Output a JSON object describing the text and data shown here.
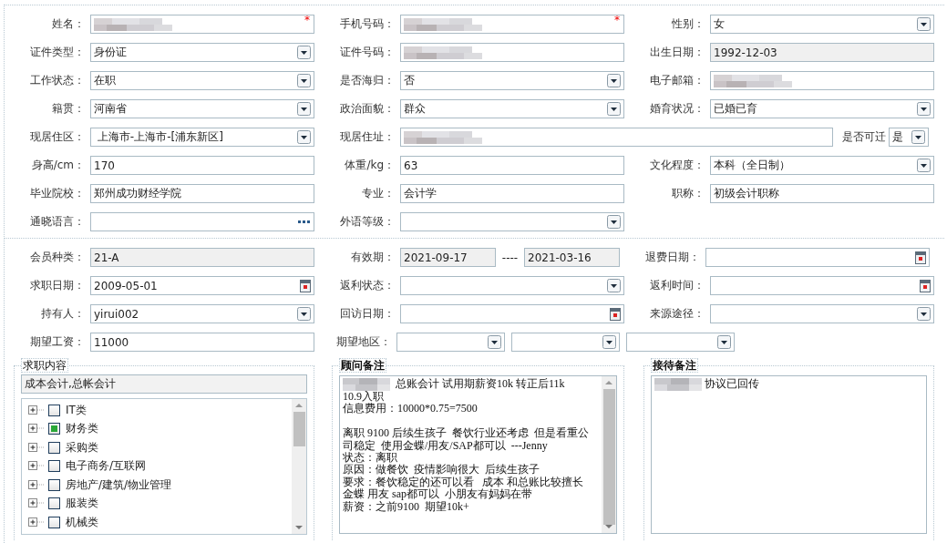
{
  "sections": [
    {
      "rows": [
        {
          "cells": [
            {
              "label": "姓名：",
              "kind": "text",
              "redacted": true,
              "required_mark": "*"
            },
            {
              "label": "手机号码：",
              "kind": "text",
              "redacted": true,
              "required_mark": "*"
            },
            {
              "label": "性别：",
              "kind": "select",
              "value": "女"
            }
          ]
        },
        {
          "cells": [
            {
              "label": "证件类型：",
              "kind": "select",
              "value": "身份证"
            },
            {
              "label": "证件号码：",
              "kind": "text",
              "redacted": true
            },
            {
              "label": "出生日期：",
              "kind": "readonly",
              "value": "1992-12-03"
            }
          ]
        },
        {
          "cells": [
            {
              "label": "工作状态：",
              "kind": "select",
              "value": "在职"
            },
            {
              "label": "是否海归：",
              "kind": "select",
              "value": "否"
            },
            {
              "label": "电子邮箱：",
              "kind": "text",
              "redacted": true
            }
          ]
        },
        {
          "cells": [
            {
              "label": "籍贯：",
              "kind": "select",
              "value": "河南省"
            },
            {
              "label": "政治面貌：",
              "kind": "select",
              "value": "群众"
            },
            {
              "label": "婚育状况：",
              "kind": "select",
              "value": "已婚已育"
            }
          ]
        },
        {
          "cells": [
            {
              "label": "现居住区：",
              "kind": "select",
              "value": " 上海市-上海市-[浦东新区]"
            },
            {
              "label": "现居住址：",
              "kind": "wide-text",
              "redacted": true
            },
            {
              "label": "是否可迁",
              "kind": "small-select",
              "value": "是"
            }
          ]
        },
        {
          "cells": [
            {
              "label": "身高/cm：",
              "kind": "text",
              "value": "170"
            },
            {
              "label": "体重/kg：",
              "kind": "text",
              "value": "63"
            },
            {
              "label": "文化程度：",
              "kind": "select",
              "value": "本科（全日制）"
            }
          ]
        },
        {
          "cells": [
            {
              "label": "毕业院校：",
              "kind": "text",
              "value": "郑州成功财经学院"
            },
            {
              "label": "专业：",
              "kind": "text",
              "value": "会计学"
            },
            {
              "label": "职称：",
              "kind": "text",
              "value": "初级会计职称"
            }
          ]
        },
        {
          "cells": [
            {
              "label": "通晓语言：",
              "kind": "lookup"
            },
            {
              "label": "外语等级：",
              "kind": "select"
            }
          ]
        }
      ]
    },
    {
      "rows": [
        {
          "cells": [
            {
              "label": "会员种类：",
              "kind": "readonly",
              "value": "21-A"
            },
            {
              "label": "有效期：",
              "kind": "date-range",
              "from": "2021-09-17",
              "separator": "----",
              "to": "2021-03-16"
            },
            {
              "label": "退费日期：",
              "kind": "date"
            }
          ]
        },
        {
          "cells": [
            {
              "label": "求职日期：",
              "kind": "date",
              "value": "2009-05-01"
            },
            {
              "label": "返利状态：",
              "kind": "select"
            },
            {
              "label": "返利时间：",
              "kind": "date"
            }
          ]
        },
        {
          "cells": [
            {
              "label": "持有人：",
              "kind": "select",
              "value": "yirui002"
            },
            {
              "label": "回访日期：",
              "kind": "date"
            },
            {
              "label": "来源途径：",
              "kind": "select"
            }
          ]
        },
        {
          "cells": [
            {
              "label": "期望工资：",
              "kind": "text",
              "value": "11000"
            },
            {
              "label": "期望地区：",
              "kind": "triple-select",
              "parts": [
                {
                  "kind": "select"
                },
                {
                  "kind": "select"
                },
                {
                  "kind": "select"
                }
              ]
            }
          ]
        }
      ]
    }
  ],
  "job_panel": {
    "legend": "求职内容",
    "summary": "成本会计,总帐会计",
    "tree": [
      {
        "label": "IT类",
        "checked": false,
        "expanded": false
      },
      {
        "label": "财务类",
        "checked": true,
        "expanded": false
      },
      {
        "label": "采购类",
        "checked": false,
        "expanded": false
      },
      {
        "label": "电子商务/互联网",
        "checked": false,
        "expanded": false
      },
      {
        "label": "房地产/建筑/物业管理",
        "checked": false,
        "expanded": false
      },
      {
        "label": "服装类",
        "checked": false,
        "expanded": false
      },
      {
        "label": "机械类",
        "checked": false,
        "expanded": false
      }
    ]
  },
  "notes": [
    {
      "legend": "顾问备注",
      "redacted": true,
      "scrollbar": true,
      "paragraphs": [
        [
          "  总账会计 试用期薪资10k 转正后11k",
          "10.9入职",
          "信息费用：10000*0.75=7500"
        ],
        [
          "离职 9100 后续生孩子  餐饮行业还考虑  但是看重公司稳定  使用金蝶/用友/SAP都可以  ---Jenny",
          "状态：离职",
          "原因：做餐饮  疫情影响很大  后续生孩子",
          "要求：餐饮稳定的还可以看   成本 和总账比较擅长",
          "金蝶 用友 sap都可以  小朋友有妈妈在带",
          "薪资：之前9100  期望10k+"
        ]
      ]
    },
    {
      "legend": "接待备注",
      "redacted": true,
      "scrollbar": false,
      "paragraphs": [
        [
          " 协议已回传"
        ]
      ]
    }
  ]
}
